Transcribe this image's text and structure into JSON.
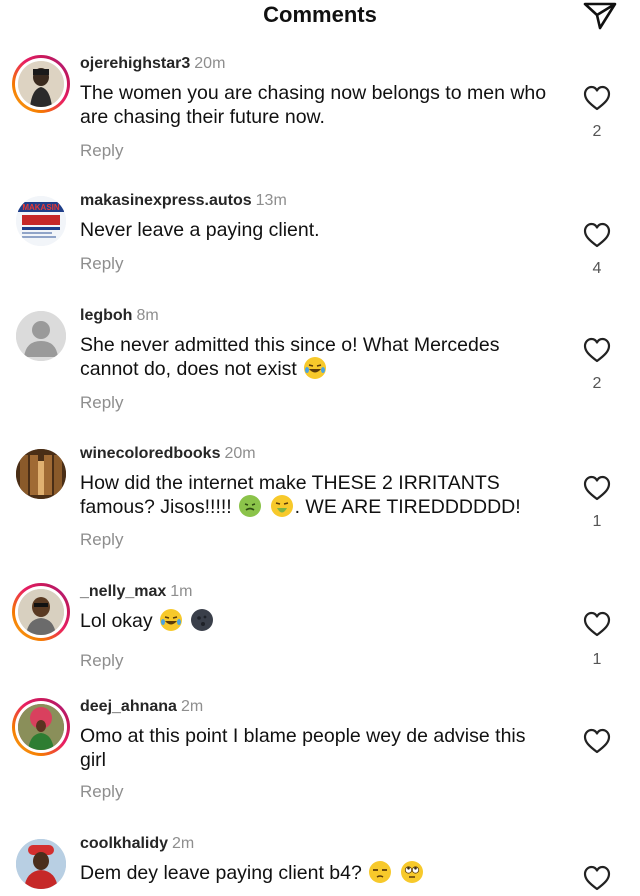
{
  "header": {
    "title": "Comments",
    "share_icon": "send-icon"
  },
  "comments": [
    {
      "username": "ojerehighstar3",
      "time": "20m",
      "text": "The women you are chasing now belongs to men who are chasing their future now.",
      "reply_label": "Reply",
      "like_count": "2",
      "story_ring": true
    },
    {
      "username": "makasinexpress.autos",
      "time": "13m",
      "text": "Never leave a paying client.",
      "reply_label": "Reply",
      "like_count": "4",
      "story_ring": false
    },
    {
      "username": "legboh",
      "time": "8m",
      "text": "She never admitted this since o! What Mercedes cannot do, does not exist",
      "reply_label": "Reply",
      "like_count": "2",
      "story_ring": false
    },
    {
      "username": "winecoloredbooks",
      "time": "20m",
      "text_before": "How did the internet make THESE 2 IRRITANTS famous?  Jisos!!!!!",
      "text_after": ". WE ARE TIREDDDDDD!",
      "reply_label": "Reply",
      "like_count": "1",
      "story_ring": false
    },
    {
      "username": "_nelly_max",
      "time": "1m",
      "text": "Lol okay",
      "reply_label": "Reply",
      "like_count": "1",
      "story_ring": true
    },
    {
      "username": "deej_ahnana",
      "time": "2m",
      "text": "Omo at this point I blame people wey de advise this girl",
      "reply_label": "Reply",
      "like_count": "",
      "story_ring": true
    },
    {
      "username": "coolkhalidy",
      "time": "2m",
      "text": "Dem dey leave paying client b4?",
      "reply_label": "",
      "like_count": "",
      "story_ring": false
    }
  ],
  "avatar_logo_text": "MAKASIN",
  "icons": {
    "like": "heart-outline-icon",
    "share": "send-icon"
  },
  "colors": {
    "username": "#262626",
    "meta": "#8e8e8e",
    "story_ring_start": "#f9a825",
    "story_ring_end": "#9c27b0"
  }
}
